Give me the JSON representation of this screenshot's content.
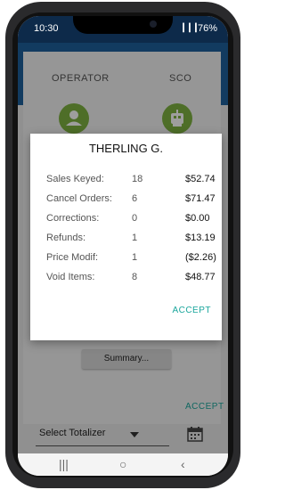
{
  "status_bar": {
    "time": "10:30",
    "signal": "▎▎▎",
    "battery": "76%"
  },
  "roles": {
    "operator_label": "OPERATOR",
    "sco_label": "SCO"
  },
  "dialog": {
    "title": "THERLING G.",
    "rows": [
      {
        "label": "Sales Keyed:",
        "count": "18",
        "amount": "$52.74"
      },
      {
        "label": "Cancel Orders:",
        "count": "6",
        "amount": "$71.47"
      },
      {
        "label": "Corrections:",
        "count": "0",
        "amount": "$0.00"
      },
      {
        "label": "Refunds:",
        "count": "1",
        "amount": "$13.19"
      },
      {
        "label": "Price Modif:",
        "count": "1",
        "amount": "($2.26)"
      },
      {
        "label": "Void Items:",
        "count": "8",
        "amount": "$48.77"
      }
    ],
    "accept_label": "ACCEPT"
  },
  "summary_button": "Summary...",
  "accept_bottom": "ACCEPT",
  "totalizer": {
    "selected": "Select Totalizer"
  },
  "nav": {
    "recents": "|||",
    "home": "○",
    "back": "‹"
  },
  "colors": {
    "accent": "#1aa69c",
    "role_icon": "#7fb241",
    "header_blue": "#1d5f9c"
  }
}
